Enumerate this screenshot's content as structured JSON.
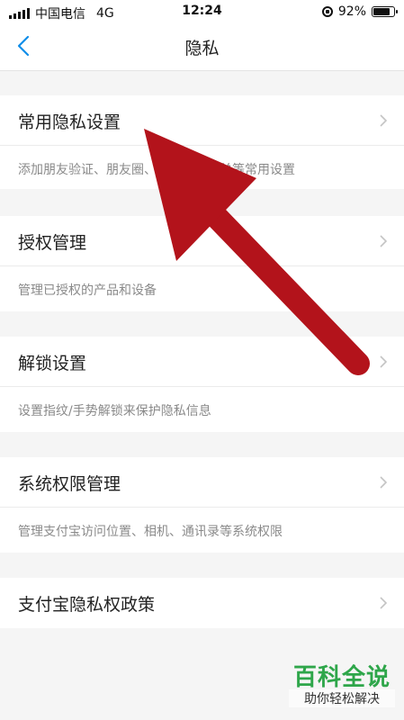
{
  "status_bar": {
    "carrier": "中国电信",
    "network": "4G",
    "time": "12:24",
    "battery_percent": "92%",
    "battery_level": 0.92
  },
  "nav": {
    "back_icon": "chevron-left-icon",
    "title": "隐私"
  },
  "sections": [
    {
      "label": "常用隐私设置",
      "description": "添加朋友验证、朋友圈、通讯录黑名单等常用设置"
    },
    {
      "label": "授权管理",
      "description": "管理已授权的产品和设备"
    },
    {
      "label": "解锁设置",
      "description": "设置指纹/手势解锁来保护隐私信息"
    },
    {
      "label": "系统权限管理",
      "description": "管理支付宝访问位置、相机、通讯录等系统权限"
    },
    {
      "label": "支付宝隐私权政策"
    }
  ],
  "annotation": {
    "arrow_color": "#b3131b"
  },
  "watermark": {
    "title": "百科全说",
    "subtitle": "助你轻松解决"
  },
  "colors": {
    "accent": "#108ee9",
    "background": "#f5f5f5",
    "watermark_green": "#2ea64a"
  }
}
